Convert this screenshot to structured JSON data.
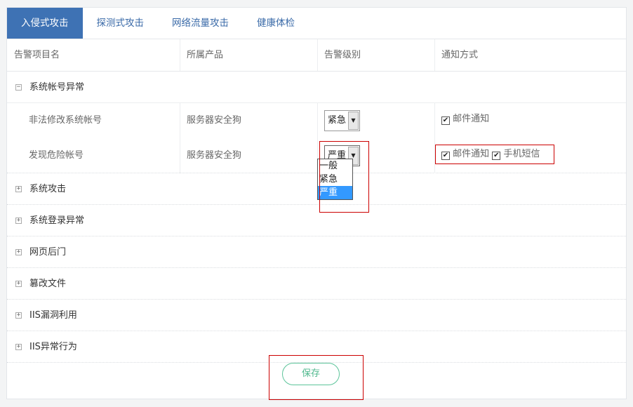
{
  "tabs": [
    "入侵式攻击",
    "探测式攻击",
    "网络流量攻击",
    "健康体检"
  ],
  "columns": [
    "告警项目名",
    "所属产品",
    "告警级别",
    "通知方式"
  ],
  "expanded_group": {
    "label": "系统帐号异常",
    "toggle": "−",
    "rows": [
      {
        "name": "非法修改系统帐号",
        "product": "服务器安全狗",
        "level": "紧急",
        "notify": [
          "邮件通知"
        ]
      },
      {
        "name": "发现危险帐号",
        "product": "服务器安全狗",
        "level": "严重",
        "notify": [
          "邮件通知",
          "手机短信"
        ]
      }
    ]
  },
  "collapsed_groups": [
    "系统攻击",
    "系统登录异常",
    "网页后门",
    "篡改文件",
    "IIS漏洞利用",
    "IIS异常行为"
  ],
  "collapsed_toggle": "+",
  "dropdown_options": [
    "一般",
    "紧急",
    "严重"
  ],
  "dropdown_selected": "严重",
  "save_label": "保存",
  "colors": {
    "accent": "#3e72b4",
    "save_green": "#4fb88d",
    "highlight": "#3399ff",
    "annotation_red": "#cc0000"
  }
}
